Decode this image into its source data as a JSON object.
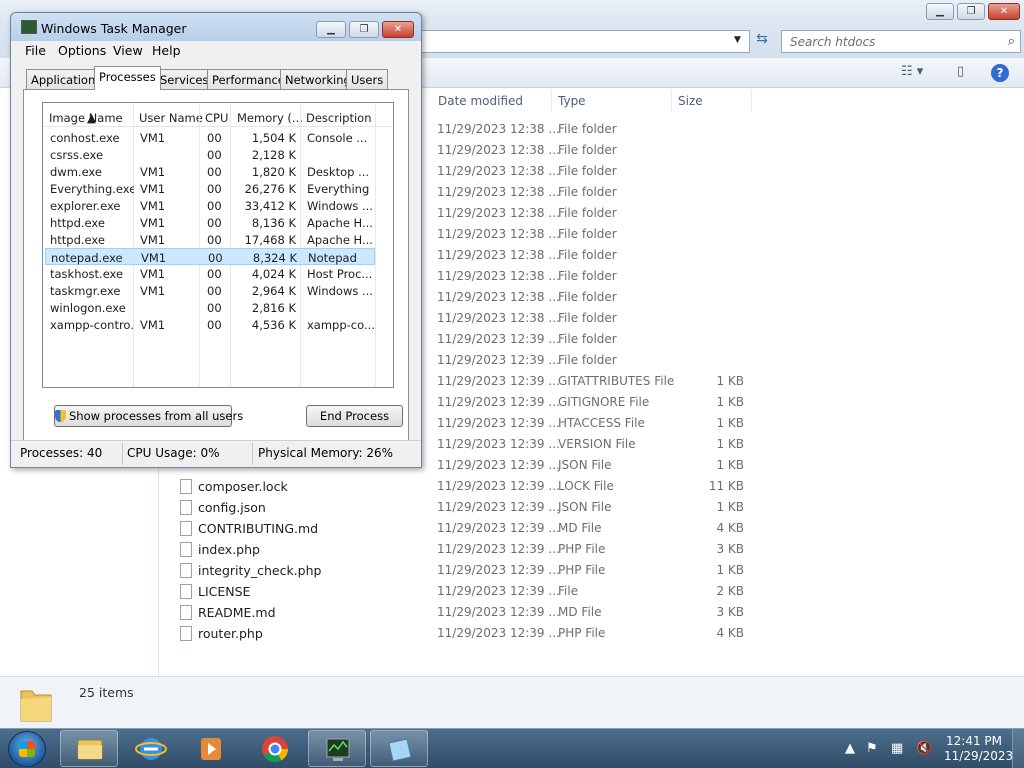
{
  "explorer": {
    "search_placeholder": "Search htdocs",
    "columns": {
      "date": "Date modified",
      "type": "Type",
      "size": "Size"
    },
    "files": [
      {
        "name": "",
        "date": "11/29/2023 12:38 ...",
        "type": "File folder",
        "size": ""
      },
      {
        "name": "",
        "date": "11/29/2023 12:38 ...",
        "type": "File folder",
        "size": ""
      },
      {
        "name": "",
        "date": "11/29/2023 12:38 ...",
        "type": "File folder",
        "size": ""
      },
      {
        "name": "",
        "date": "11/29/2023 12:38 ...",
        "type": "File folder",
        "size": ""
      },
      {
        "name": "",
        "date": "11/29/2023 12:38 ...",
        "type": "File folder",
        "size": ""
      },
      {
        "name": "",
        "date": "11/29/2023 12:38 ...",
        "type": "File folder",
        "size": ""
      },
      {
        "name": "",
        "date": "11/29/2023 12:38 ...",
        "type": "File folder",
        "size": ""
      },
      {
        "name": "",
        "date": "11/29/2023 12:38 ...",
        "type": "File folder",
        "size": ""
      },
      {
        "name": "",
        "date": "11/29/2023 12:38 ...",
        "type": "File folder",
        "size": ""
      },
      {
        "name": "",
        "date": "11/29/2023 12:38 ...",
        "type": "File folder",
        "size": ""
      },
      {
        "name": "",
        "date": "11/29/2023 12:39 ...",
        "type": "File folder",
        "size": ""
      },
      {
        "name": "",
        "date": "11/29/2023 12:39 ...",
        "type": "File folder",
        "size": ""
      },
      {
        "name": "",
        "date": "11/29/2023 12:39 ...",
        "type": "GITATTRIBUTES File",
        "size": "1 KB"
      },
      {
        "name": "",
        "date": "11/29/2023 12:39 ...",
        "type": "GITIGNORE File",
        "size": "1 KB"
      },
      {
        "name": "",
        "date": "11/29/2023 12:39 ...",
        "type": "HTACCESS File",
        "size": "1 KB"
      },
      {
        "name": "",
        "date": "11/29/2023 12:39 ...",
        "type": "VERSION File",
        "size": "1 KB"
      },
      {
        "name": "",
        "date": "11/29/2023 12:39 ...",
        "type": "JSON File",
        "size": "1 KB"
      },
      {
        "name": "composer.lock",
        "date": "11/29/2023 12:39 ...",
        "type": "LOCK File",
        "size": "11 KB"
      },
      {
        "name": "config.json",
        "date": "11/29/2023 12:39 ...",
        "type": "JSON File",
        "size": "1 KB"
      },
      {
        "name": "CONTRIBUTING.md",
        "date": "11/29/2023 12:39 ...",
        "type": "MD File",
        "size": "4 KB"
      },
      {
        "name": "index.php",
        "date": "11/29/2023 12:39 ...",
        "type": "PHP File",
        "size": "3 KB"
      },
      {
        "name": "integrity_check.php",
        "date": "11/29/2023 12:39 ...",
        "type": "PHP File",
        "size": "1 KB"
      },
      {
        "name": "LICENSE",
        "date": "11/29/2023 12:39 ...",
        "type": "File",
        "size": "2 KB"
      },
      {
        "name": "README.md",
        "date": "11/29/2023 12:39 ...",
        "type": "MD File",
        "size": "3 KB"
      },
      {
        "name": "router.php",
        "date": "11/29/2023 12:39 ...",
        "type": "PHP File",
        "size": "4 KB"
      }
    ],
    "status_count": "25 items"
  },
  "taskmgr": {
    "title": "Windows Task Manager",
    "menu": [
      "File",
      "Options",
      "View",
      "Help"
    ],
    "tabs": [
      "Applications",
      "Processes",
      "Services",
      "Performance",
      "Networking",
      "Users"
    ],
    "active_tab": "Processes",
    "columns": [
      "Image Name",
      "User Name",
      "CPU",
      "Memory (...",
      "Description"
    ],
    "processes": [
      {
        "name": "conhost.exe",
        "user": "VM1",
        "cpu": "00",
        "mem": "1,504 K",
        "desc": "Console ..."
      },
      {
        "name": "csrss.exe",
        "user": "",
        "cpu": "00",
        "mem": "2,128 K",
        "desc": ""
      },
      {
        "name": "dwm.exe",
        "user": "VM1",
        "cpu": "00",
        "mem": "1,820 K",
        "desc": "Desktop ..."
      },
      {
        "name": "Everything.exe",
        "user": "VM1",
        "cpu": "00",
        "mem": "26,276 K",
        "desc": "Everything"
      },
      {
        "name": "explorer.exe",
        "user": "VM1",
        "cpu": "00",
        "mem": "33,412 K",
        "desc": "Windows ..."
      },
      {
        "name": "httpd.exe",
        "user": "VM1",
        "cpu": "00",
        "mem": "8,136 K",
        "desc": "Apache H..."
      },
      {
        "name": "httpd.exe",
        "user": "VM1",
        "cpu": "00",
        "mem": "17,468 K",
        "desc": "Apache H..."
      },
      {
        "name": "notepad.exe",
        "user": "VM1",
        "cpu": "00",
        "mem": "8,324 K",
        "desc": "Notepad"
      },
      {
        "name": "taskhost.exe",
        "user": "VM1",
        "cpu": "00",
        "mem": "4,024 K",
        "desc": "Host Proc..."
      },
      {
        "name": "taskmgr.exe",
        "user": "VM1",
        "cpu": "00",
        "mem": "2,964 K",
        "desc": "Windows ..."
      },
      {
        "name": "winlogon.exe",
        "user": "",
        "cpu": "00",
        "mem": "2,816 K",
        "desc": ""
      },
      {
        "name": "xampp-contro...",
        "user": "VM1",
        "cpu": "00",
        "mem": "4,536 K",
        "desc": "xampp-co..."
      }
    ],
    "selected_process": "notepad.exe",
    "show_all_label": "Show processes from all users",
    "end_process_label": "End Process",
    "status": {
      "processes": "Processes: 40",
      "cpu": "CPU Usage: 0%",
      "memory": "Physical Memory: 26%"
    }
  },
  "taskbar": {
    "apps": [
      "windows-explorer-icon",
      "internet-explorer-icon",
      "media-player-icon",
      "chrome-icon",
      "task-manager-icon",
      "notepad-icon"
    ],
    "time": "12:41 PM",
    "date": "11/29/2023"
  },
  "colors": {
    "selection": "#cce8ff",
    "taskbar": "#3b5a78"
  }
}
